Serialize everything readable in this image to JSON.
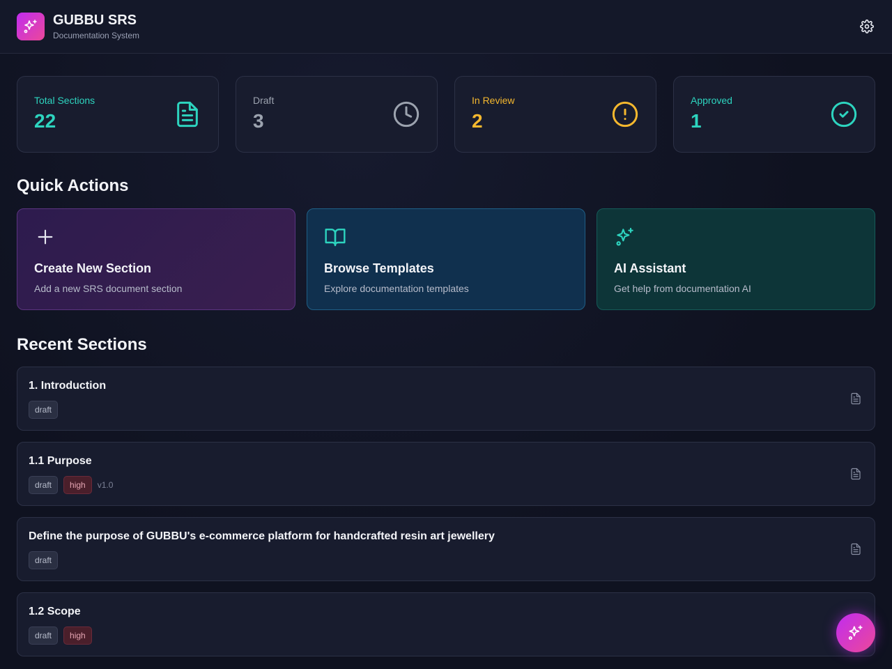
{
  "app": {
    "title": "GUBBU SRS",
    "subtitle": "Documentation System",
    "logo_icon": "sparkles-icon",
    "settings_icon": "gear-icon"
  },
  "stats": [
    {
      "label": "Total Sections",
      "value": "22",
      "color": "#2dd4bf",
      "icon": "document-icon"
    },
    {
      "label": "Draft",
      "value": "3",
      "color": "#9ca3af",
      "icon": "clock-icon"
    },
    {
      "label": "In Review",
      "value": "2",
      "color": "#f5b82e",
      "icon": "alert-circle-icon"
    },
    {
      "label": "Approved",
      "value": "1",
      "color": "#2dd4bf",
      "icon": "check-circle-icon"
    }
  ],
  "quick_actions": {
    "heading": "Quick Actions",
    "items": [
      {
        "title": "Create New Section",
        "description": "Add a new SRS document section",
        "icon": "plus-icon"
      },
      {
        "title": "Browse Templates",
        "description": "Explore documentation templates",
        "icon": "book-open-icon"
      },
      {
        "title": "AI Assistant",
        "description": "Get help from documentation AI",
        "icon": "sparkles-icon"
      }
    ]
  },
  "recent": {
    "heading": "Recent Sections",
    "items": [
      {
        "title": "1. Introduction",
        "tags": [
          "draft"
        ],
        "version": ""
      },
      {
        "title": "1.1 Purpose",
        "tags": [
          "draft",
          "high"
        ],
        "version": "v1.0"
      },
      {
        "title": "Define the purpose of GUBBU's e-commerce platform for handcrafted resin art jewellery",
        "tags": [
          "draft"
        ],
        "version": ""
      },
      {
        "title": "1.2 Scope",
        "tags": [
          "draft",
          "high"
        ],
        "version": ""
      }
    ]
  },
  "fab": {
    "icon": "sparkles-icon"
  }
}
